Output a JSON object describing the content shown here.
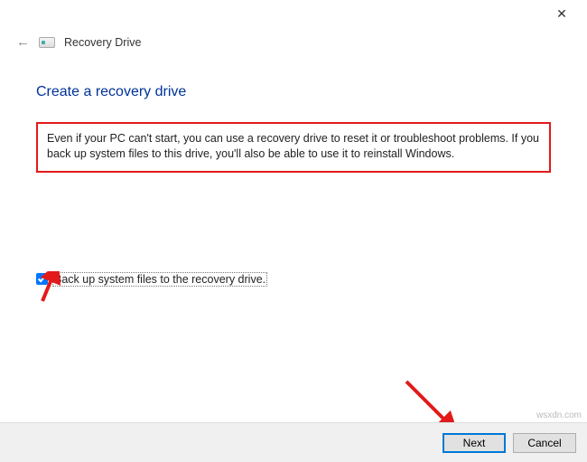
{
  "titlebar": {
    "close_symbol": "✕"
  },
  "header": {
    "back_symbol": "←",
    "window_label": "Recovery Drive"
  },
  "page": {
    "title": "Create a recovery drive",
    "description": "Even if your PC can't start, you can use a recovery drive to reset it or troubleshoot problems. If you back up system files to this drive, you'll also be able to use it to reinstall Windows."
  },
  "checkbox": {
    "label": "Back up system files to the recovery drive.",
    "checked": true
  },
  "footer": {
    "next_label": "Next",
    "cancel_label": "Cancel"
  },
  "watermark": "wsxdn.com"
}
